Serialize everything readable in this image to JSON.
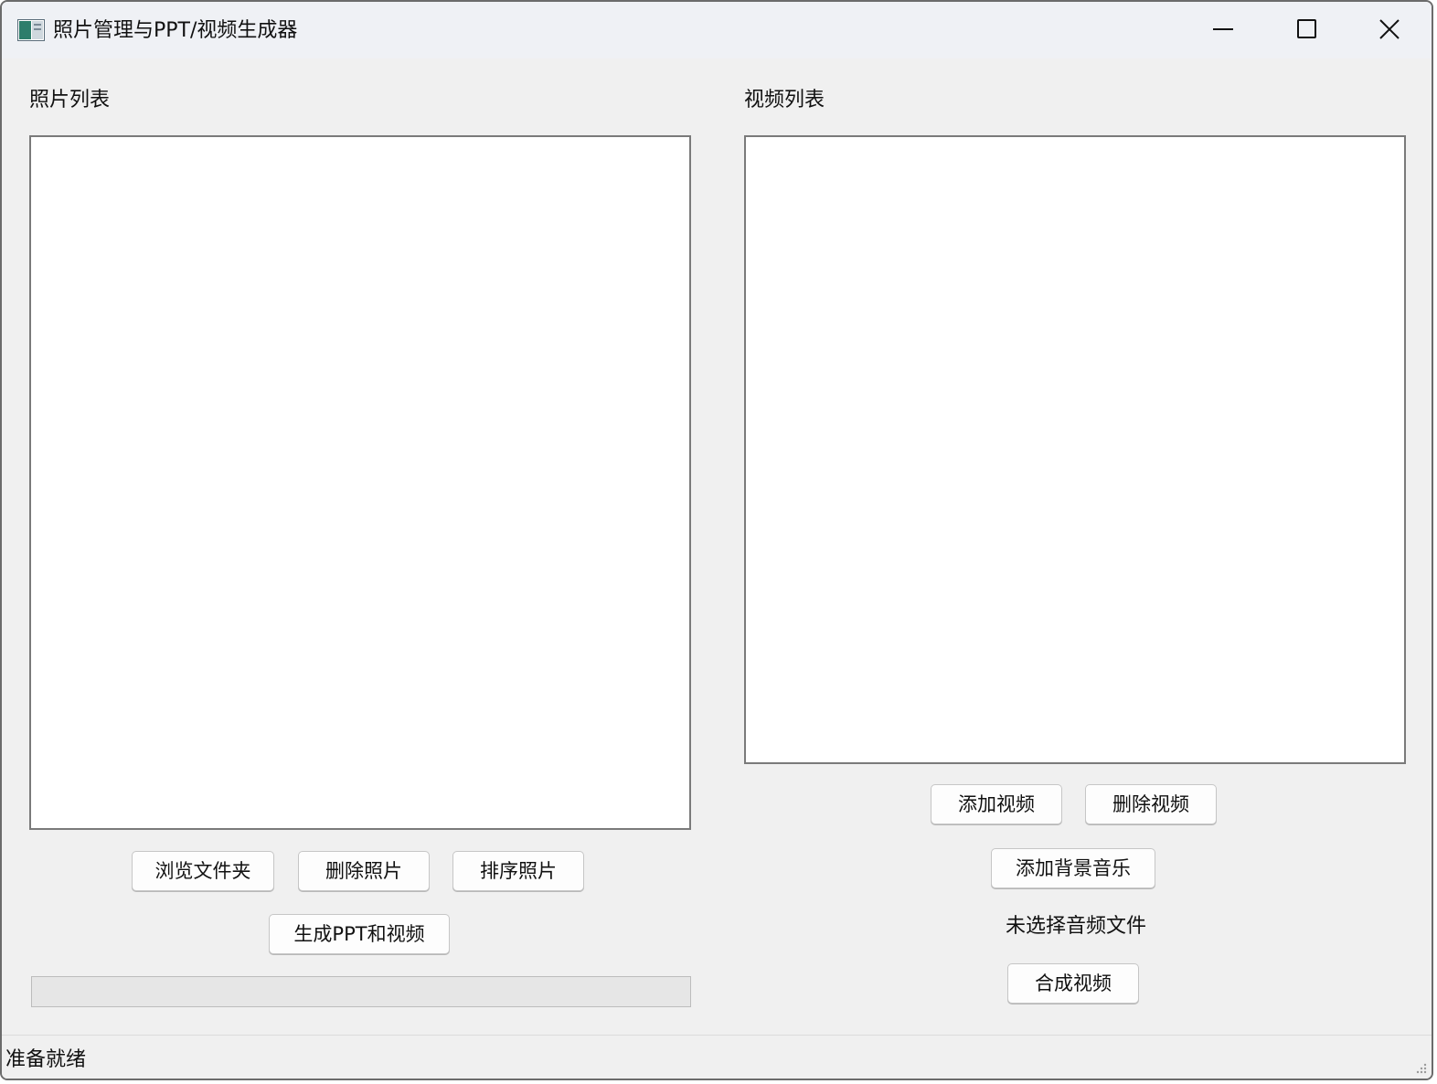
{
  "window": {
    "title": "照片管理与PPT/视频生成器",
    "icon": "app-window-icon",
    "controls": [
      "minimize-icon",
      "maximize-icon",
      "close-icon"
    ]
  },
  "photos": {
    "label": "照片列表",
    "items": [],
    "buttons": {
      "browse": "浏览文件夹",
      "delete": "删除照片",
      "sort": "排序照片",
      "generate": "生成PPT和视频"
    },
    "progress": 0
  },
  "videos": {
    "label": "视频列表",
    "items": [],
    "buttons": {
      "add": "添加视频",
      "delete": "删除视频",
      "add_music": "添加背景音乐",
      "compose": "合成视频"
    },
    "audio_status": "未选择音频文件"
  },
  "statusbar": {
    "text": "准备就绪"
  },
  "colors": {
    "window_bg": "#f0f0f0",
    "titlebar_bg": "#eff1f5",
    "list_bg": "#ffffff",
    "progress_fill": "#06b025"
  }
}
